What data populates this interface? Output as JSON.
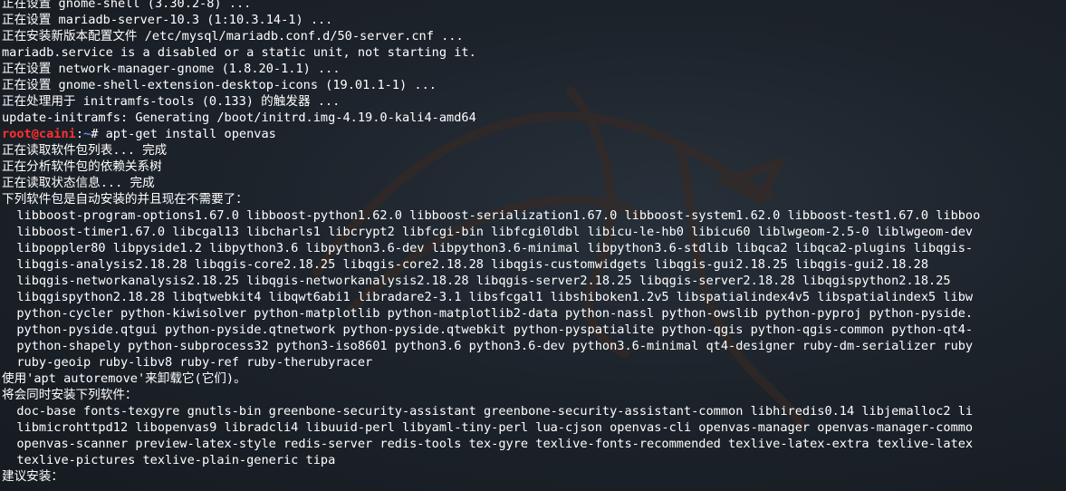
{
  "terminal": {
    "prompt": {
      "user_host": "root@caini",
      "separator": ":",
      "path": "~",
      "symbol": "# "
    },
    "lines": [
      "正在设置 gnome-shell (3.30.2-8) ...",
      "正在设置 mariadb-server-10.3 (1:10.3.14-1) ...",
      "正在安装新版本配置文件 /etc/mysql/mariadb.conf.d/50-server.cnf ...",
      "mariadb.service is a disabled or a static unit, not starting it.",
      "正在设置 network-manager-gnome (1.8.20-1.1) ...",
      "正在设置 gnome-shell-extension-desktop-icons (19.01.1-1) ...",
      "正在处理用于 initramfs-tools (0.133) 的触发器 ...",
      "update-initramfs: Generating /boot/initrd.img-4.19.0-kali4-amd64",
      "apt-get install openvas",
      "正在读取软件包列表... 完成",
      "正在分析软件包的依赖关系树",
      "正在读取状态信息... 完成",
      "下列软件包是自动安装的并且现在不需要了：",
      "  libboost-program-options1.67.0 libboost-python1.62.0 libboost-serialization1.67.0 libboost-system1.62.0 libboost-test1.67.0 libboo",
      "  libboost-timer1.67.0 libcgal13 libcharls1 libcrypt2 libfcgi-bin libfcgi0ldbl libicu-le-hb0 libicu60 liblwgeom-2.5-0 liblwgeom-dev",
      "  libpoppler80 libpyside1.2 libpython3.6 libpython3.6-dev libpython3.6-minimal libpython3.6-stdlib libqca2 libqca2-plugins libqgis-",
      "  libqgis-analysis2.18.28 libqgis-core2.18.25 libqgis-core2.18.28 libqgis-customwidgets libqgis-gui2.18.25 libqgis-gui2.18.28",
      "  libqgis-networkanalysis2.18.25 libqgis-networkanalysis2.18.28 libqgis-server2.18.25 libqgis-server2.18.28 libqgispython2.18.25",
      "  libqgispython2.18.28 libqtwebkit4 libqwt6abi1 libradare2-3.1 libsfcgal1 libshiboken1.2v5 libspatialindex4v5 libspatialindex5 libw",
      "  python-cycler python-kiwisolver python-matplotlib python-matplotlib2-data python-nassl python-owslib python-pyproj python-pyside.",
      "  python-pyside.qtgui python-pyside.qtnetwork python-pyside.qtwebkit python-pyspatialite python-qgis python-qgis-common python-qt4-",
      "  python-shapely python-subprocess32 python3-iso8601 python3.6 python3.6-dev python3.6-minimal qt4-designer ruby-dm-serializer ruby",
      "  ruby-geoip ruby-libv8 ruby-ref ruby-therubyracer",
      "使用'apt autoremove'来卸载它(它们)。",
      "将会同时安装下列软件：",
      "  doc-base fonts-texgyre gnutls-bin greenbone-security-assistant greenbone-security-assistant-common libhiredis0.14 libjemalloc2 li",
      "  libmicrohttpd12 libopenvas9 libradcli4 libuuid-perl libyaml-tiny-perl lua-cjson openvas-cli openvas-manager openvas-manager-commo",
      "  openvas-scanner preview-latex-style redis-server redis-tools tex-gyre texlive-fonts-recommended texlive-latex-extra texlive-latex",
      "  texlive-pictures texlive-plain-generic tipa",
      "建议安装：",
      "  "
    ]
  },
  "colors": {
    "background": "#1d232b",
    "text": "#ffffff",
    "prompt_user": "#ff3030",
    "prompt_path": "#5f8ee8"
  },
  "icons": {
    "background": "kali-dragon-watermark"
  }
}
